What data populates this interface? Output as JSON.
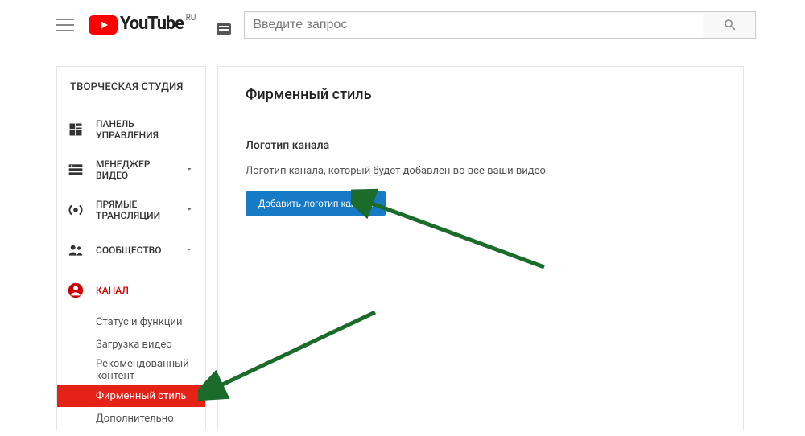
{
  "header": {
    "logo_text": "YouTube",
    "locale_suffix": "RU",
    "search_placeholder": "Введите запрос"
  },
  "sidebar": {
    "title": "ТВОРЧЕСКАЯ СТУДИЯ",
    "items": [
      {
        "label": "ПАНЕЛЬ УПРАВЛЕНИЯ",
        "icon": "dashboard-icon",
        "chev": false
      },
      {
        "label": "МЕНЕДЖЕР ВИДЕО",
        "icon": "video-manager-icon",
        "chev": true
      },
      {
        "label": "ПРЯМЫЕ ТРАНСЛЯЦИИ",
        "icon": "live-icon",
        "chev": true
      },
      {
        "label": "СООБЩЕСТВО",
        "icon": "community-icon",
        "chev": true
      },
      {
        "label": "КАНАЛ",
        "icon": "channel-icon",
        "chev": false
      }
    ],
    "channel_sub": [
      "Статус и функции",
      "Загрузка видео",
      "Рекомендованный контент",
      "Фирменный стиль",
      "Дополнительно"
    ]
  },
  "main": {
    "title": "Фирменный стиль",
    "section_heading": "Логотип канала",
    "section_desc": "Логотип канала, который будет добавлен во все ваши видео.",
    "add_button": "Добавить логотип канала"
  }
}
